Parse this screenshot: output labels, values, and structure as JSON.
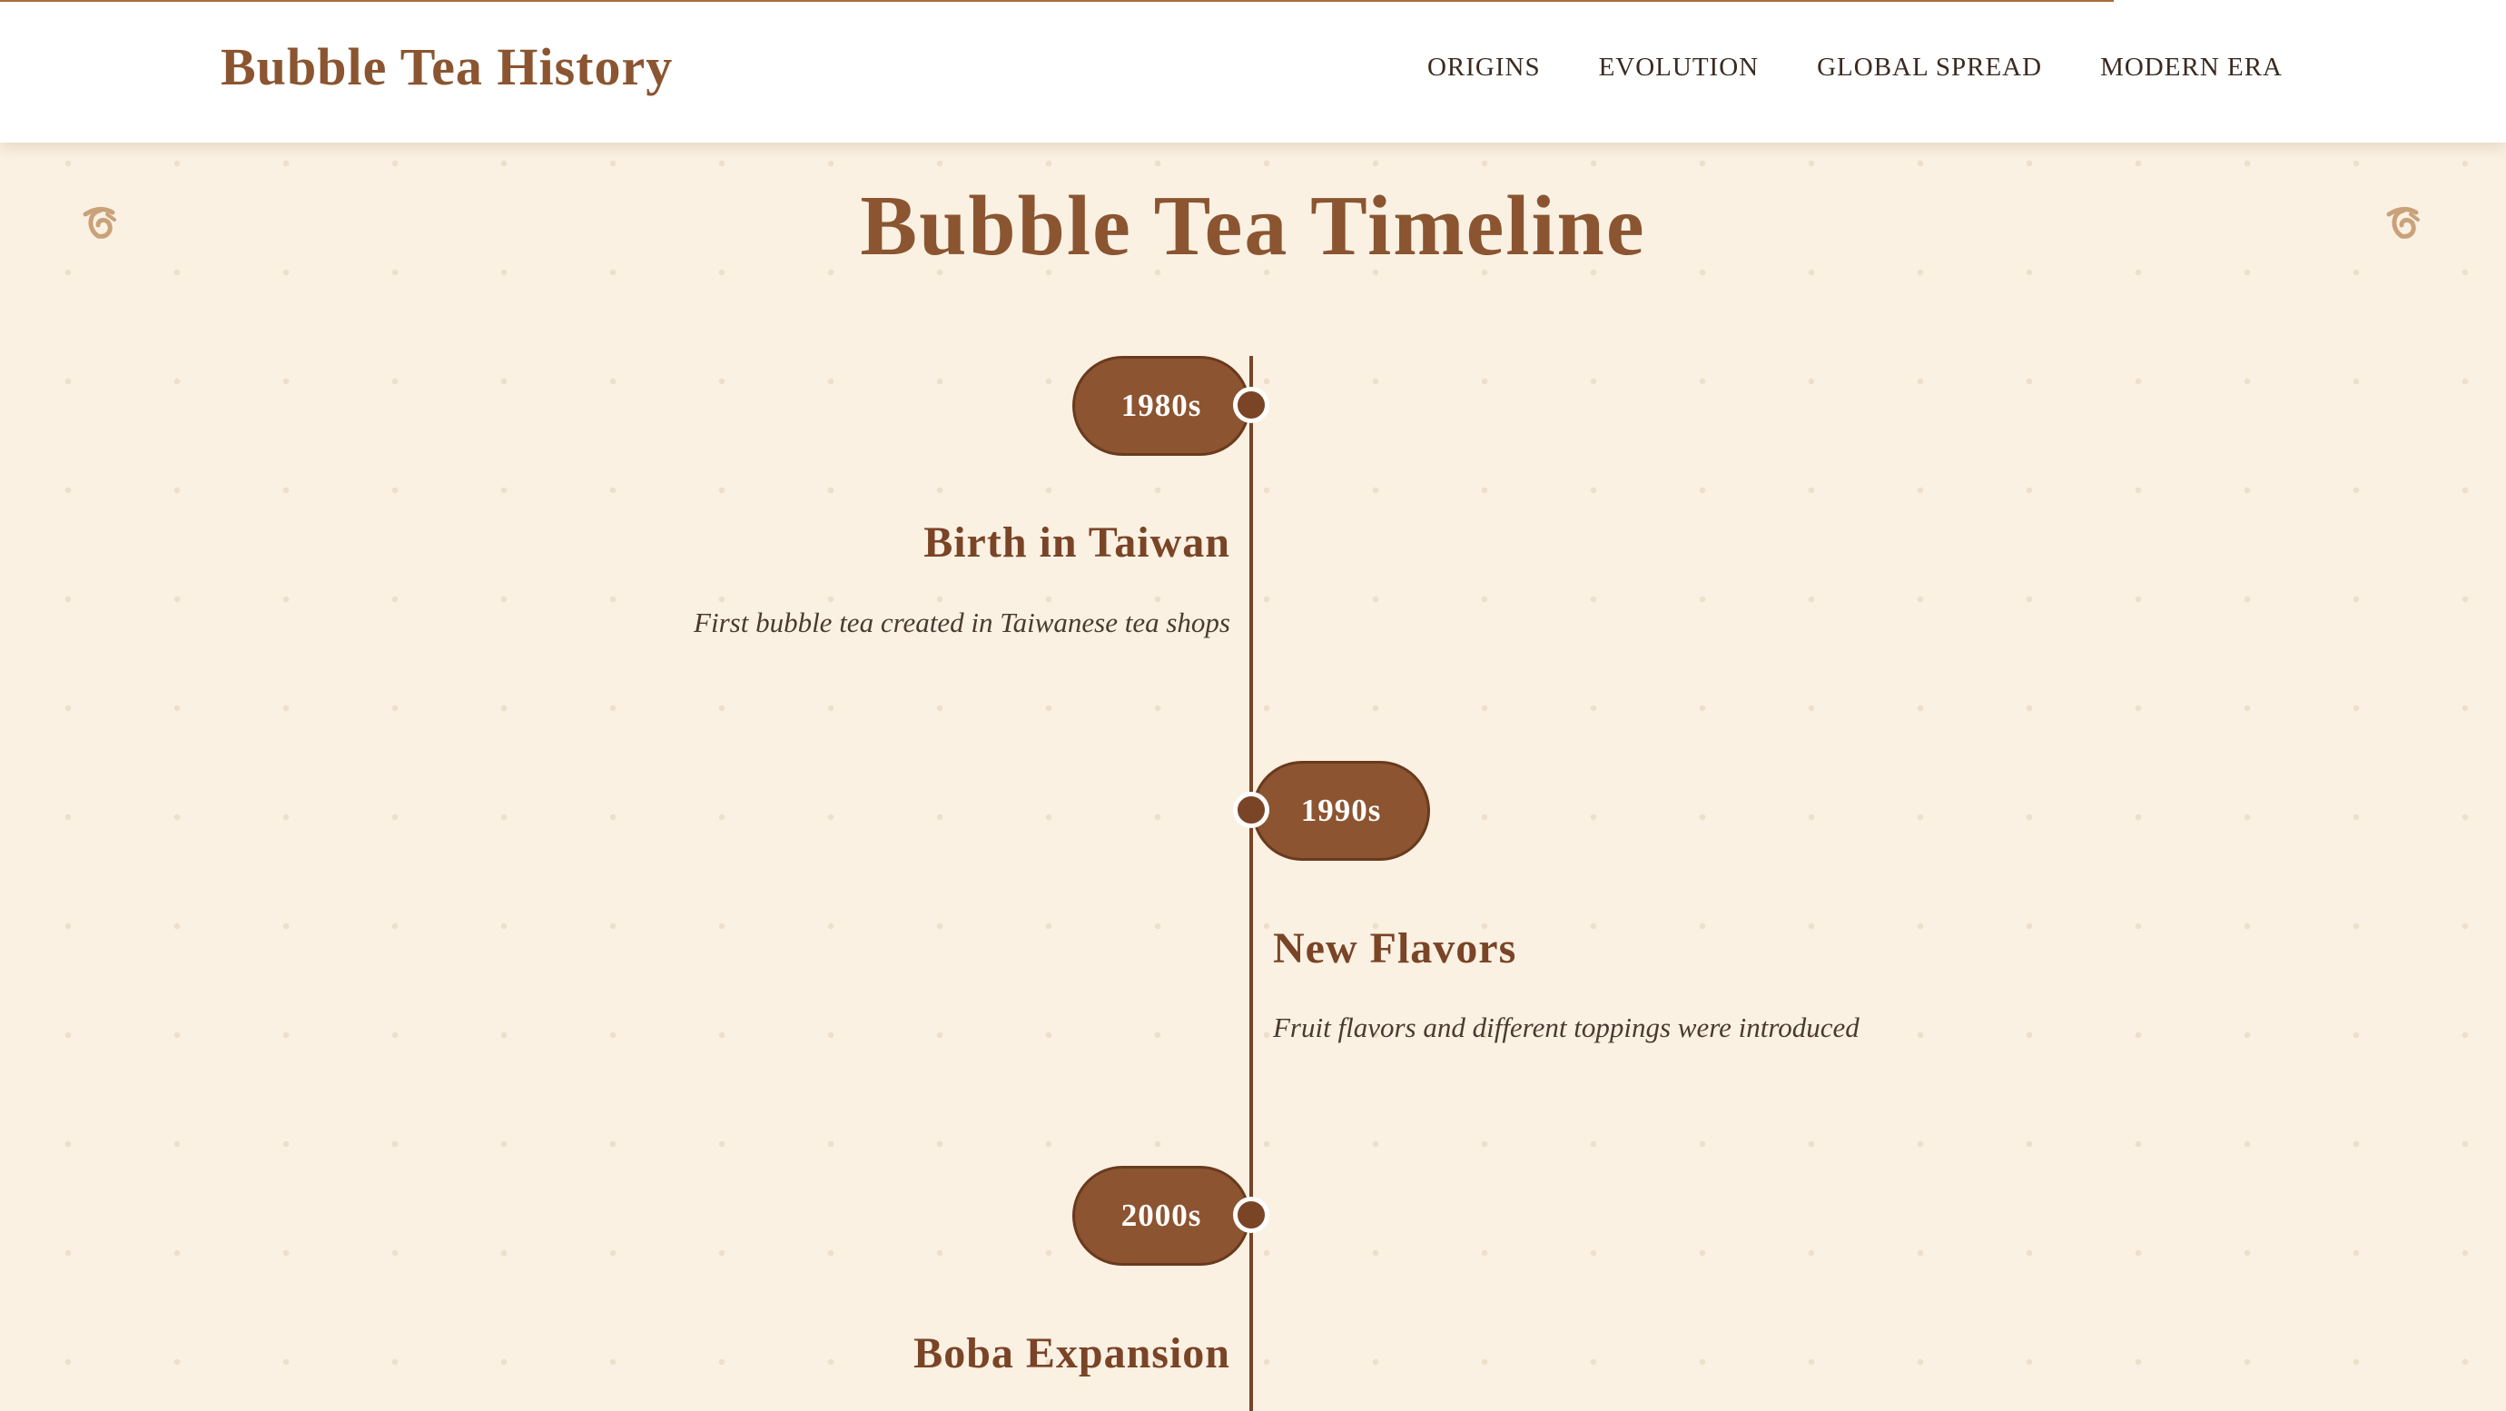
{
  "header": {
    "site_title": "Bubble Tea History",
    "nav": [
      "ORIGINS",
      "EVOLUTION",
      "GLOBAL SPREAD",
      "MODERN ERA"
    ]
  },
  "page_title": "Bubble Tea Timeline",
  "decoration": {
    "icon": "tea-leaf-icon"
  },
  "timeline": [
    {
      "year": "1980s",
      "title": "Birth in Taiwan",
      "description": "First bubble tea created in Taiwanese tea shops",
      "side": "left"
    },
    {
      "year": "1990s",
      "title": "New Flavors",
      "description": "Fruit flavors and different toppings were introduced",
      "side": "right"
    },
    {
      "year": "2000s",
      "title": "Boba Expansion",
      "side": "left"
    }
  ],
  "colors": {
    "background": "#faf1e3",
    "accent": "#8a5530",
    "pill": "#8c5430",
    "axis": "#7a4426",
    "deco": "#c9a27a"
  }
}
